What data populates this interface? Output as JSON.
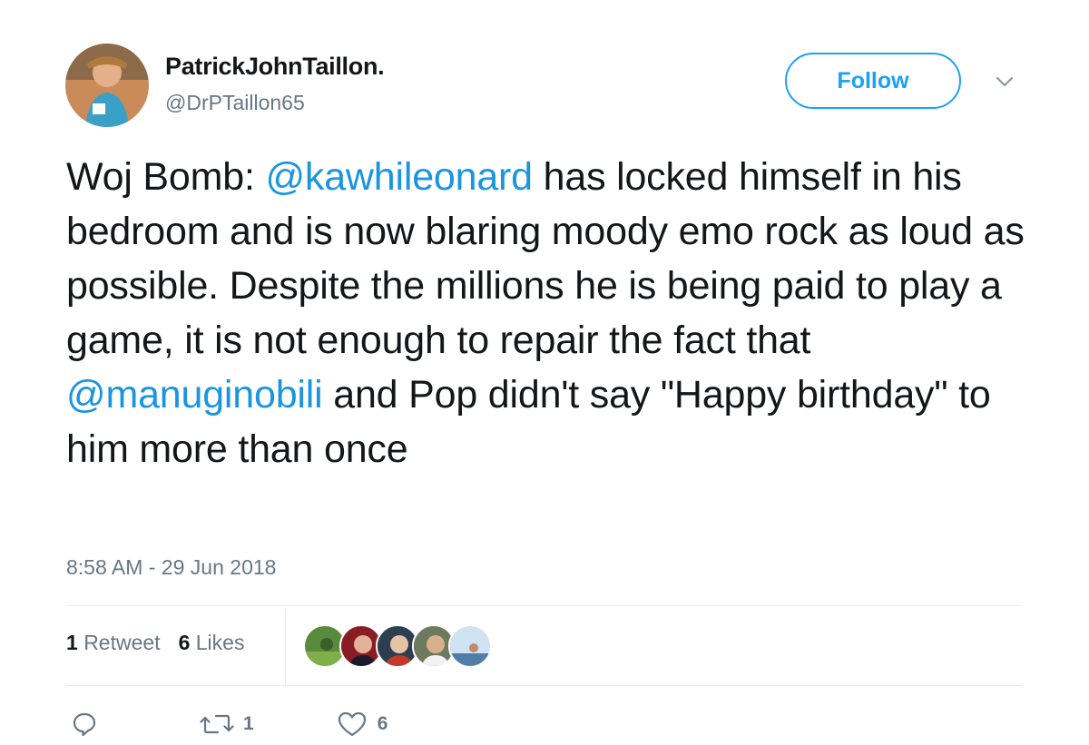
{
  "user": {
    "name": "PatrickJohnTaillon.",
    "handle": "@DrPTaillon65"
  },
  "follow_label": "Follow",
  "tweet": {
    "t1": "Woj Bomb: ",
    "mention1": "@kawhileonard",
    "t2": " has locked himself in his bedroom and is now blaring moody emo rock as loud as possible. Despite the millions he is being paid to play a game, it is not enough to repair the fact that ",
    "mention2": "@manuginobili",
    "t3": " and Pop didn't say \"Happy birthday\"  to him more than once"
  },
  "timestamp": "8:58 AM - 29 Jun 2018",
  "stats": {
    "retweets_count": "1",
    "retweets_label": "Retweet",
    "likes_count": "6",
    "likes_label": "Likes"
  },
  "actions": {
    "retweet_count": "1",
    "like_count": "6"
  },
  "colors": {
    "accent": "#1da1f2",
    "mention": "#1b95e0",
    "secondary_text": "#657786"
  },
  "icons": [
    "reply-icon",
    "retweet-icon",
    "like-icon",
    "chevron-down-icon"
  ]
}
